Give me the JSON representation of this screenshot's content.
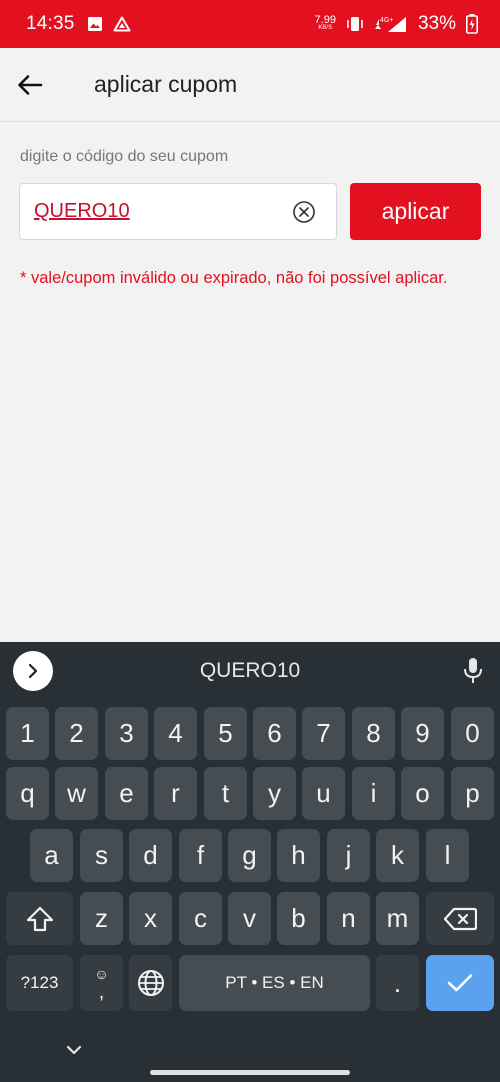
{
  "status_bar": {
    "time": "14:35",
    "net_speed_value": "7.99",
    "net_speed_unit": "KB/S",
    "network": "4G+",
    "battery": "33%",
    "icons": [
      "image-icon",
      "drive-icon",
      "vibrate-icon",
      "signal-icon",
      "battery-icon"
    ]
  },
  "header": {
    "title": "aplicar cupom",
    "back_icon": "arrow-left-icon"
  },
  "coupon": {
    "label": "digite o código do seu cupom",
    "value": "QUERO10",
    "apply_label": "aplicar",
    "error": "* vale/cupom inválido ou expirado, não foi possível aplicar."
  },
  "keyboard": {
    "suggestion": "QUERO10",
    "row_numbers": [
      "1",
      "2",
      "3",
      "4",
      "5",
      "6",
      "7",
      "8",
      "9",
      "0"
    ],
    "row_top": [
      "q",
      "w",
      "e",
      "r",
      "t",
      "y",
      "u",
      "i",
      "o",
      "p"
    ],
    "row_middle": [
      "a",
      "s",
      "d",
      "f",
      "g",
      "h",
      "j",
      "k",
      "l"
    ],
    "row_bottom": [
      "z",
      "x",
      "c",
      "v",
      "b",
      "n",
      "m"
    ],
    "symbols_label": "?123",
    "comma_label": ",",
    "emoji_label": "☺",
    "space_label": "PT • ES • EN",
    "period_label": "."
  },
  "colors": {
    "brand_red": "#e3101f",
    "keyboard_bg": "#293035",
    "key_bg": "#454c52",
    "enter_key": "#5aa2f0"
  }
}
